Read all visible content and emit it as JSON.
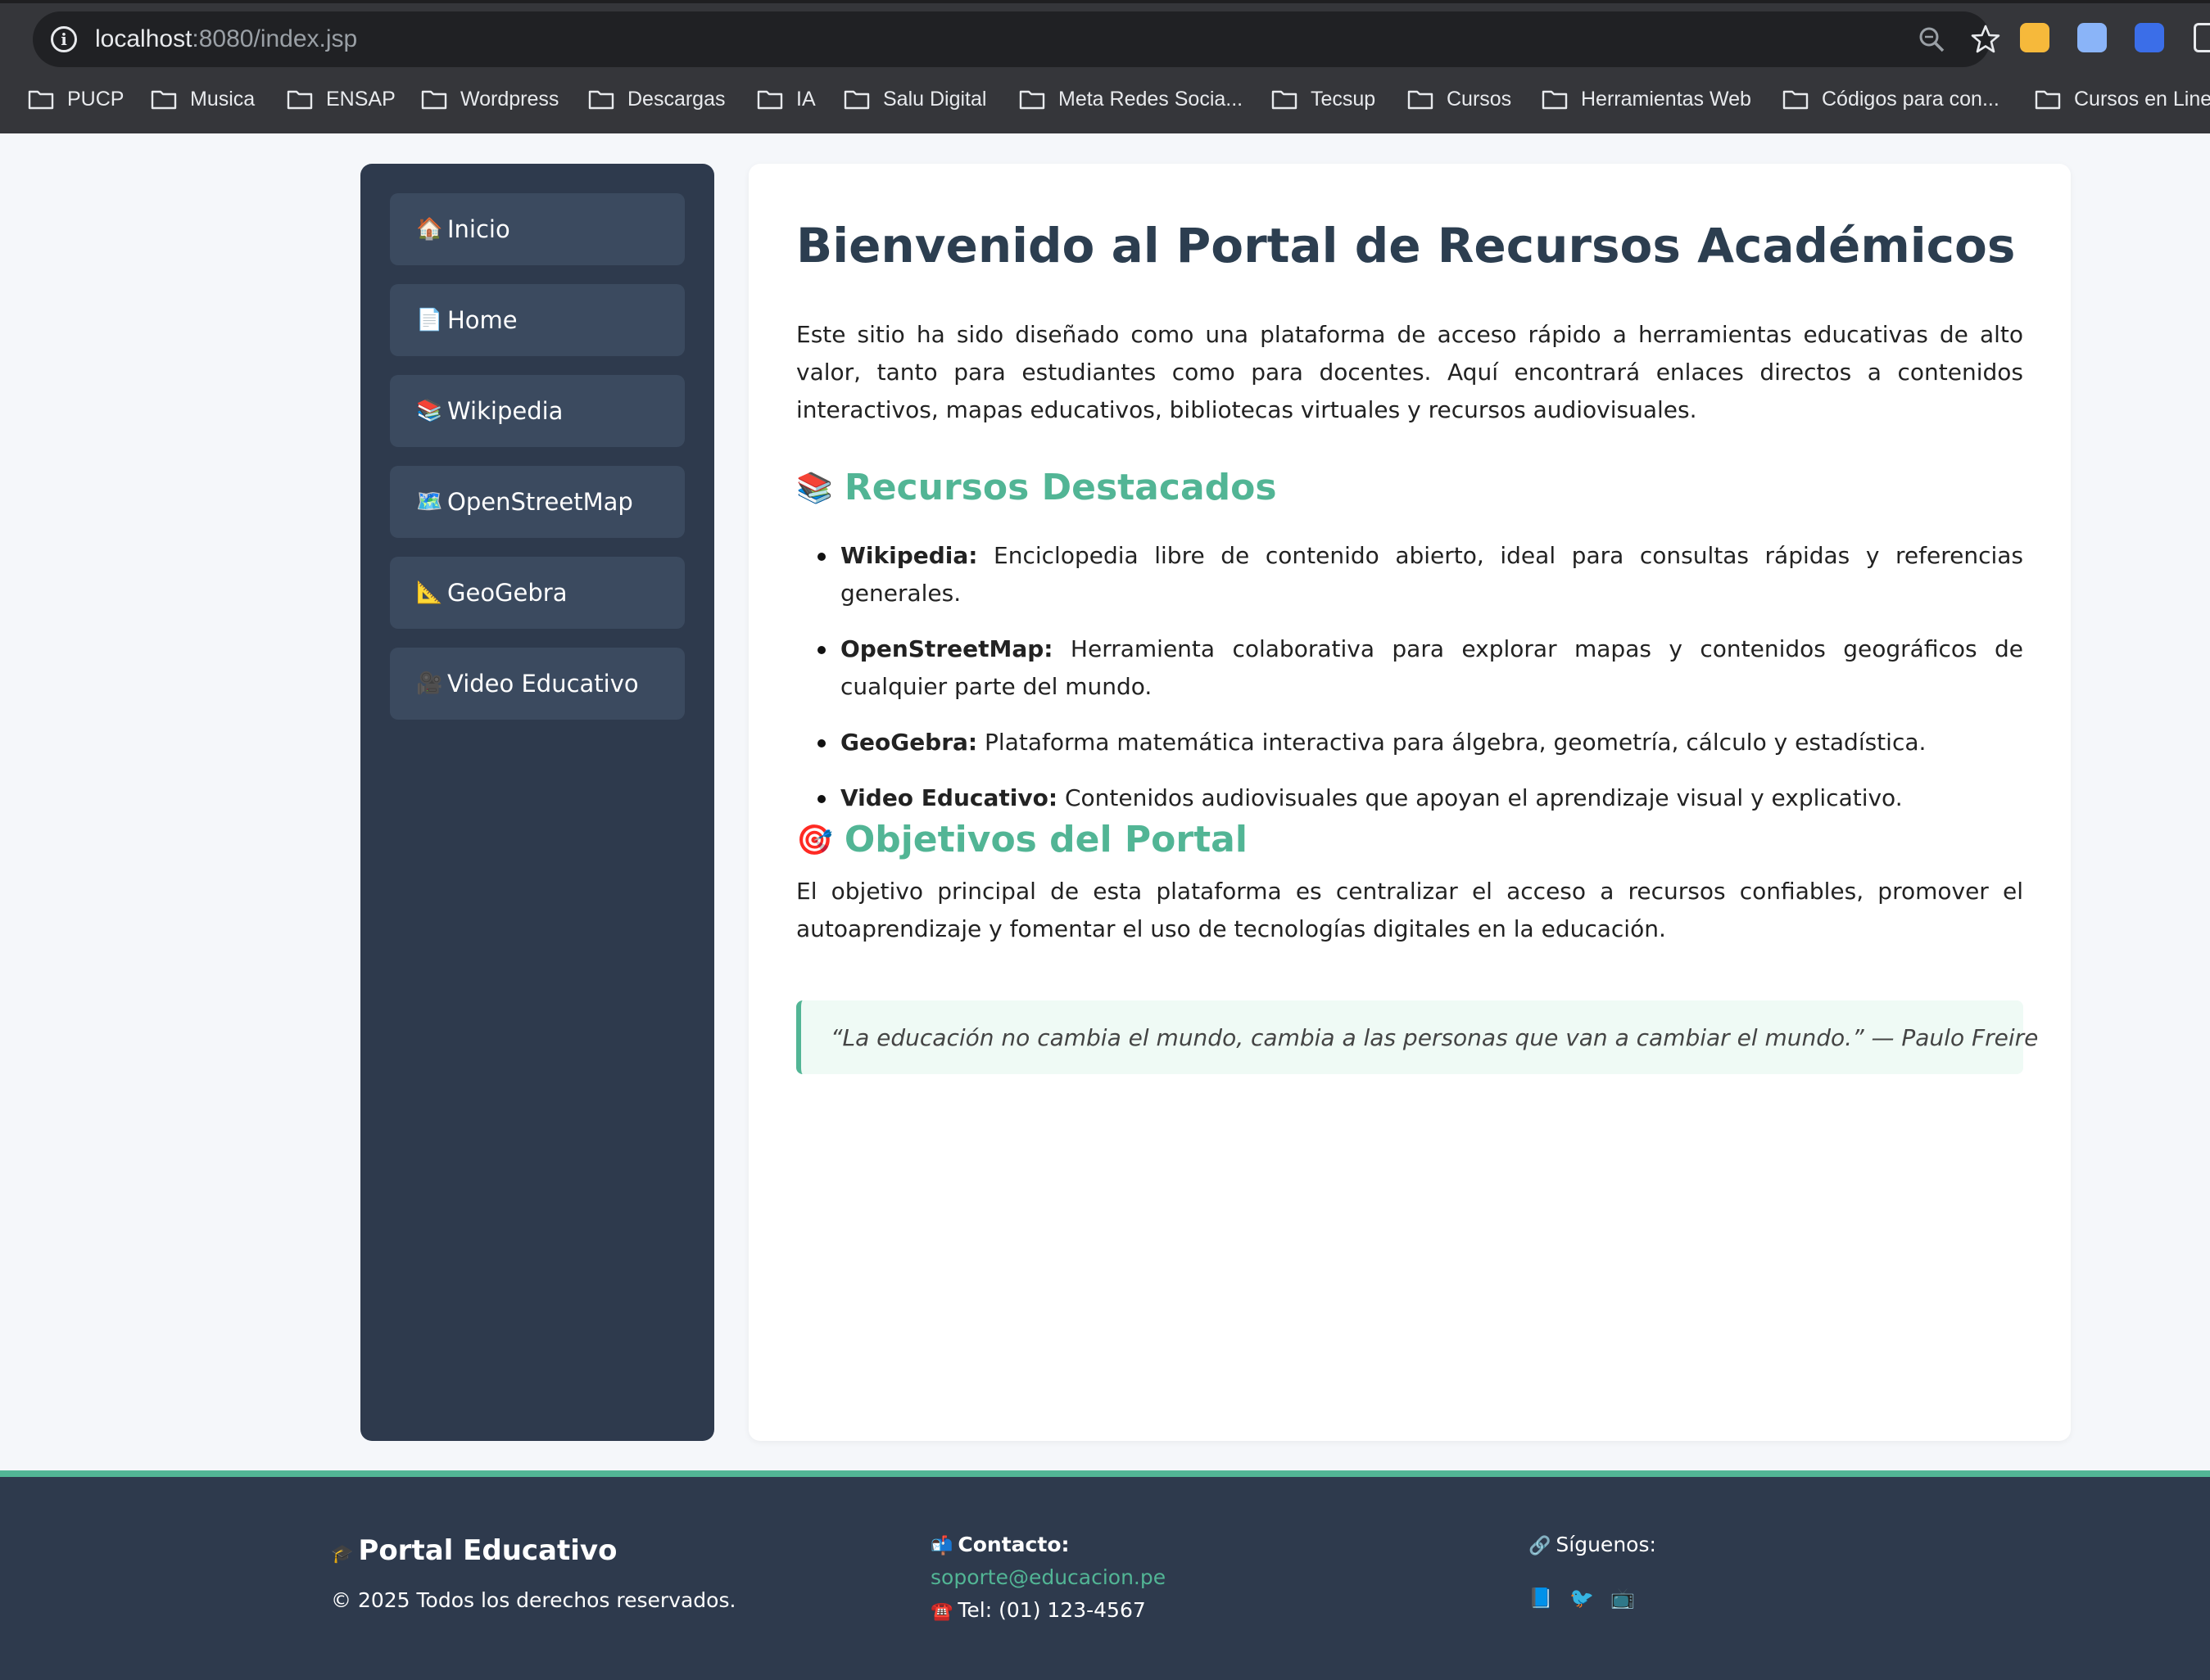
{
  "browser": {
    "url_host": "localhost",
    "url_path": ":8080/index.jsp",
    "bookmarks": [
      "PUCP",
      "Musica",
      "ENSAP",
      "Wordpress",
      "Descargas",
      "IA",
      "Salu Digital",
      "Meta Redes Socia...",
      "Tecsup",
      "Cursos",
      "Herramientas Web",
      "Códigos para con...",
      "Cursos en Line"
    ]
  },
  "sidebar": {
    "items": [
      {
        "icon": "🏠",
        "label": "Inicio"
      },
      {
        "icon": "📄",
        "label": "Home"
      },
      {
        "icon": "📚",
        "label": "Wikipedia"
      },
      {
        "icon": "🗺️",
        "label": "OpenStreetMap"
      },
      {
        "icon": "📐",
        "label": "GeoGebra"
      },
      {
        "icon": "🎥",
        "label": "Video Educativo"
      }
    ]
  },
  "main": {
    "title": "Bienvenido al Portal de Recursos Académicos",
    "intro": "Este sitio ha sido diseñado como una plataforma de acceso rápido a herramientas educativas de alto valor, tanto para estudiantes como para docentes. Aquí encontrará enlaces directos a contenidos interactivos, mapas educativos, bibliotecas virtuales y recursos audiovisuales.",
    "resources_heading": {
      "icon": "📚",
      "label": "Recursos Destacados"
    },
    "resources": [
      {
        "name": "Wikipedia:",
        "desc": " Enciclopedia libre de contenido abierto, ideal para consultas rápidas y referencias generales."
      },
      {
        "name": "OpenStreetMap:",
        "desc": " Herramienta colaborativa para explorar mapas y contenidos geográficos de cualquier parte del mundo."
      },
      {
        "name": "GeoGebra:",
        "desc": " Plataforma matemática interactiva para álgebra, geometría, cálculo y estadística."
      },
      {
        "name": "Video Educativo:",
        "desc": " Contenidos audiovisuales que apoyan el aprendizaje visual y explicativo."
      }
    ],
    "objectives_heading": {
      "icon": "🎯",
      "label": "Objetivos del Portal"
    },
    "objectives_text": "El objetivo principal de esta plataforma es centralizar el acceso a recursos confiables, promover el autoaprendizaje y fomentar el uso de tecnologías digitales en la educación.",
    "quote": "“La educación no cambia el mundo, cambia a las personas que van a cambiar el mundo.” — Paulo Freire"
  },
  "footer": {
    "brand_icon": "🎓",
    "brand": "Portal Educativo",
    "copyright": "© 2025 Todos los derechos reservados.",
    "contact_icon": "📬",
    "contact_title": "Contacto:",
    "email": "soporte@educacion.pe",
    "tel_icon": "☎️",
    "tel": "Tel: (01) 123-4567",
    "follow_icon": "🔗",
    "follow": "Síguenos:",
    "social": [
      "📘",
      "🐦",
      "📺"
    ]
  },
  "colors": {
    "accent": "#52b595",
    "sidebar_bg": "#2e3a4d",
    "nav_item_bg": "#3b4a5f",
    "title": "#2c3e50"
  }
}
